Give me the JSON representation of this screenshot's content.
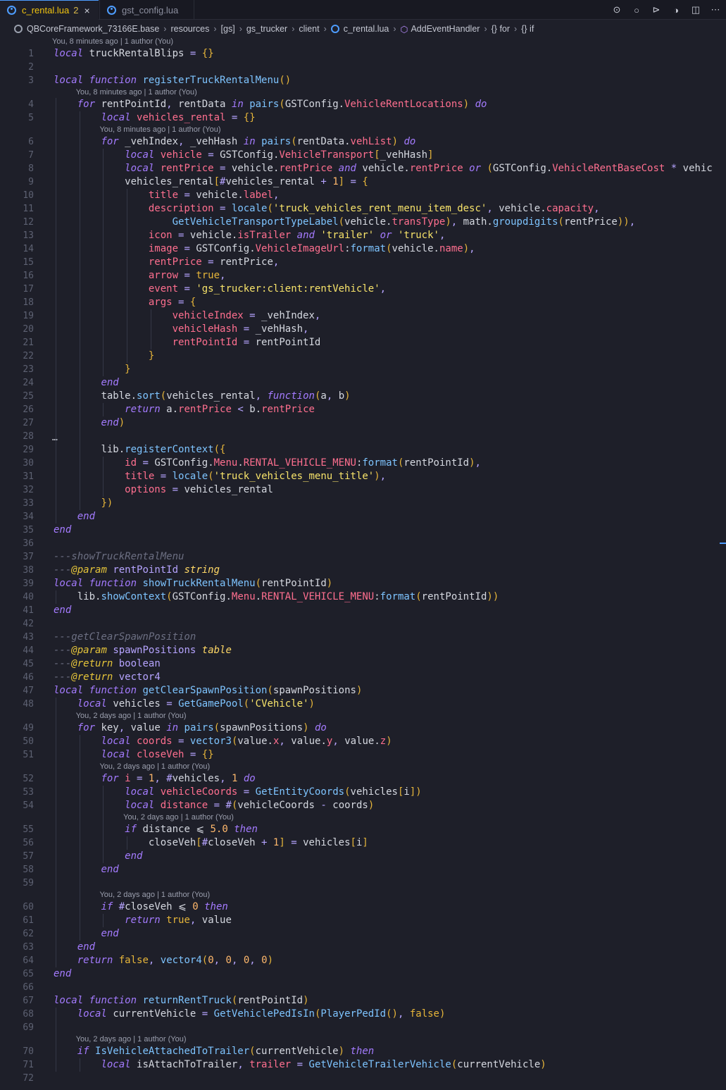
{
  "tabs": [
    {
      "label": "c_rental.lua",
      "badge": "2",
      "active": true
    },
    {
      "label": "gst_config.lua",
      "active": false
    }
  ],
  "breadcrumb": [
    "QBCoreFramework_73166E.base",
    "resources",
    "[gs]",
    "gs_trucker",
    "client",
    "c_rental.lua",
    "AddEventHandler",
    "{} for",
    "{} if"
  ],
  "toolbar_icons": [
    "go-back-icon",
    "go-forward-circle-icon",
    "go-forward-icon",
    "open-changes-icon",
    "split-editor-icon",
    "more-actions-icon"
  ],
  "colors": {
    "background": "#1e1f29",
    "keyword": "#a47bff",
    "string": "#f7e36a",
    "function": "#7ec4ff",
    "property": "#ff6f8f",
    "accent": "#4e9dff"
  },
  "blame": {
    "b8": "You, 8 minutes ago | 1 author (You)",
    "b2": "You, 2 days ago | 1 author (You)"
  },
  "folded_marker": "…",
  "code_lines": [
    {
      "n": 1,
      "raw": "local truckRentalBlips = {}"
    },
    {
      "n": 2,
      "raw": ""
    },
    {
      "n": 3,
      "raw": "local function registerTruckRentalMenu()"
    },
    {
      "n": 4,
      "raw": "    for rentPointId, rentData in pairs(GSTConfig.VehicleRentLocations) do"
    },
    {
      "n": 5,
      "raw": "        local vehicles_rental = {}"
    },
    {
      "n": 6,
      "raw": "        for _vehIndex, _vehHash in pairs(rentData.vehList) do"
    },
    {
      "n": 7,
      "raw": "            local vehicle = GSTConfig.VehicleTransport[_vehHash]"
    },
    {
      "n": 8,
      "raw": "            local rentPrice = vehicle.rentPrice and vehicle.rentPrice or (GSTConfig.VehicleRentBaseCost * vehic"
    },
    {
      "n": 9,
      "raw": "            vehicles_rental[#vehicles_rental + 1] = {"
    },
    {
      "n": 10,
      "raw": "                title = vehicle.label,"
    },
    {
      "n": 11,
      "raw": "                description = locale('truck_vehicles_rent_menu_item_desc', vehicle.capacity,"
    },
    {
      "n": 12,
      "raw": "                    GetVehicleTransportTypeLabel(vehicle.transType), math.groupdigits(rentPrice)),"
    },
    {
      "n": 13,
      "raw": "                icon = vehicle.isTrailer and 'trailer' or 'truck',"
    },
    {
      "n": 14,
      "raw": "                image = GSTConfig.VehicleImageUrl:format(vehicle.name),"
    },
    {
      "n": 15,
      "raw": "                rentPrice = rentPrice,"
    },
    {
      "n": 16,
      "raw": "                arrow = true,"
    },
    {
      "n": 17,
      "raw": "                event = 'gs_trucker:client:rentVehicle',"
    },
    {
      "n": 18,
      "raw": "                args = {"
    },
    {
      "n": 19,
      "raw": "                    vehicleIndex = _vehIndex,"
    },
    {
      "n": 20,
      "raw": "                    vehicleHash = _vehHash,"
    },
    {
      "n": 21,
      "raw": "                    rentPointId = rentPointId"
    },
    {
      "n": 22,
      "raw": "                }"
    },
    {
      "n": 23,
      "raw": "            }"
    },
    {
      "n": 24,
      "raw": "        end"
    },
    {
      "n": 25,
      "raw": "        table.sort(vehicles_rental, function(a, b)"
    },
    {
      "n": 26,
      "raw": "            return a.rentPrice < b.rentPrice"
    },
    {
      "n": 27,
      "raw": "        end)"
    },
    {
      "n": 28,
      "raw": ""
    },
    {
      "n": 29,
      "raw": "        lib.registerContext({"
    },
    {
      "n": 30,
      "raw": "            id = GSTConfig.Menu.RENTAL_VEHICLE_MENU:format(rentPointId),"
    },
    {
      "n": 31,
      "raw": "            title = locale('truck_vehicles_menu_title'),"
    },
    {
      "n": 32,
      "raw": "            options = vehicles_rental"
    },
    {
      "n": 33,
      "raw": "        })"
    },
    {
      "n": 34,
      "raw": "    end"
    },
    {
      "n": 35,
      "raw": "end"
    },
    {
      "n": 36,
      "raw": ""
    },
    {
      "n": 37,
      "raw": "---showTruckRentalMenu"
    },
    {
      "n": 38,
      "raw": "---@param rentPointId string"
    },
    {
      "n": 39,
      "raw": "local function showTruckRentalMenu(rentPointId)"
    },
    {
      "n": 40,
      "raw": "    lib.showContext(GSTConfig.Menu.RENTAL_VEHICLE_MENU:format(rentPointId))"
    },
    {
      "n": 41,
      "raw": "end"
    },
    {
      "n": 42,
      "raw": ""
    },
    {
      "n": 43,
      "raw": "---getClearSpawnPosition"
    },
    {
      "n": 44,
      "raw": "---@param spawnPositions table"
    },
    {
      "n": 45,
      "raw": "---@return boolean"
    },
    {
      "n": 46,
      "raw": "---@return vector4"
    },
    {
      "n": 47,
      "raw": "local function getClearSpawnPosition(spawnPositions)"
    },
    {
      "n": 48,
      "raw": "    local vehicles = GetGamePool('CVehicle')"
    },
    {
      "n": 49,
      "raw": "    for key, value in pairs(spawnPositions) do"
    },
    {
      "n": 50,
      "raw": "        local coords = vector3(value.x, value.y, value.z)"
    },
    {
      "n": 51,
      "raw": "        local closeVeh = {}"
    },
    {
      "n": 52,
      "raw": "        for i = 1, #vehicles, 1 do"
    },
    {
      "n": 53,
      "raw": "            local vehicleCoords = GetEntityCoords(vehicles[i])"
    },
    {
      "n": 54,
      "raw": "            local distance = #(vehicleCoords - coords)"
    },
    {
      "n": 55,
      "raw": "            if distance <= 5.0 then"
    },
    {
      "n": 56,
      "raw": "                closeVeh[#closeVeh + 1] = vehicles[i]"
    },
    {
      "n": 57,
      "raw": "            end"
    },
    {
      "n": 58,
      "raw": "        end"
    },
    {
      "n": 59,
      "raw": ""
    },
    {
      "n": 60,
      "raw": "        if #closeVeh <= 0 then"
    },
    {
      "n": 61,
      "raw": "            return true, value"
    },
    {
      "n": 62,
      "raw": "        end"
    },
    {
      "n": 63,
      "raw": "    end"
    },
    {
      "n": 64,
      "raw": "    return false, vector4(0, 0, 0, 0)"
    },
    {
      "n": 65,
      "raw": "end"
    },
    {
      "n": 66,
      "raw": ""
    },
    {
      "n": 67,
      "raw": "local function returnRentTruck(rentPointId)"
    },
    {
      "n": 68,
      "raw": "    local currentVehicle = GetVehiclePedIsIn(PlayerPedId(), false)"
    },
    {
      "n": 69,
      "raw": ""
    },
    {
      "n": 70,
      "raw": "    if IsVehicleAttachedToTrailer(currentVehicle) then"
    },
    {
      "n": 71,
      "raw": "        local isAttachToTrailer, trailer = GetVehicleTrailerVehicle(currentVehicle)"
    },
    {
      "n": 72,
      "raw": ""
    }
  ]
}
